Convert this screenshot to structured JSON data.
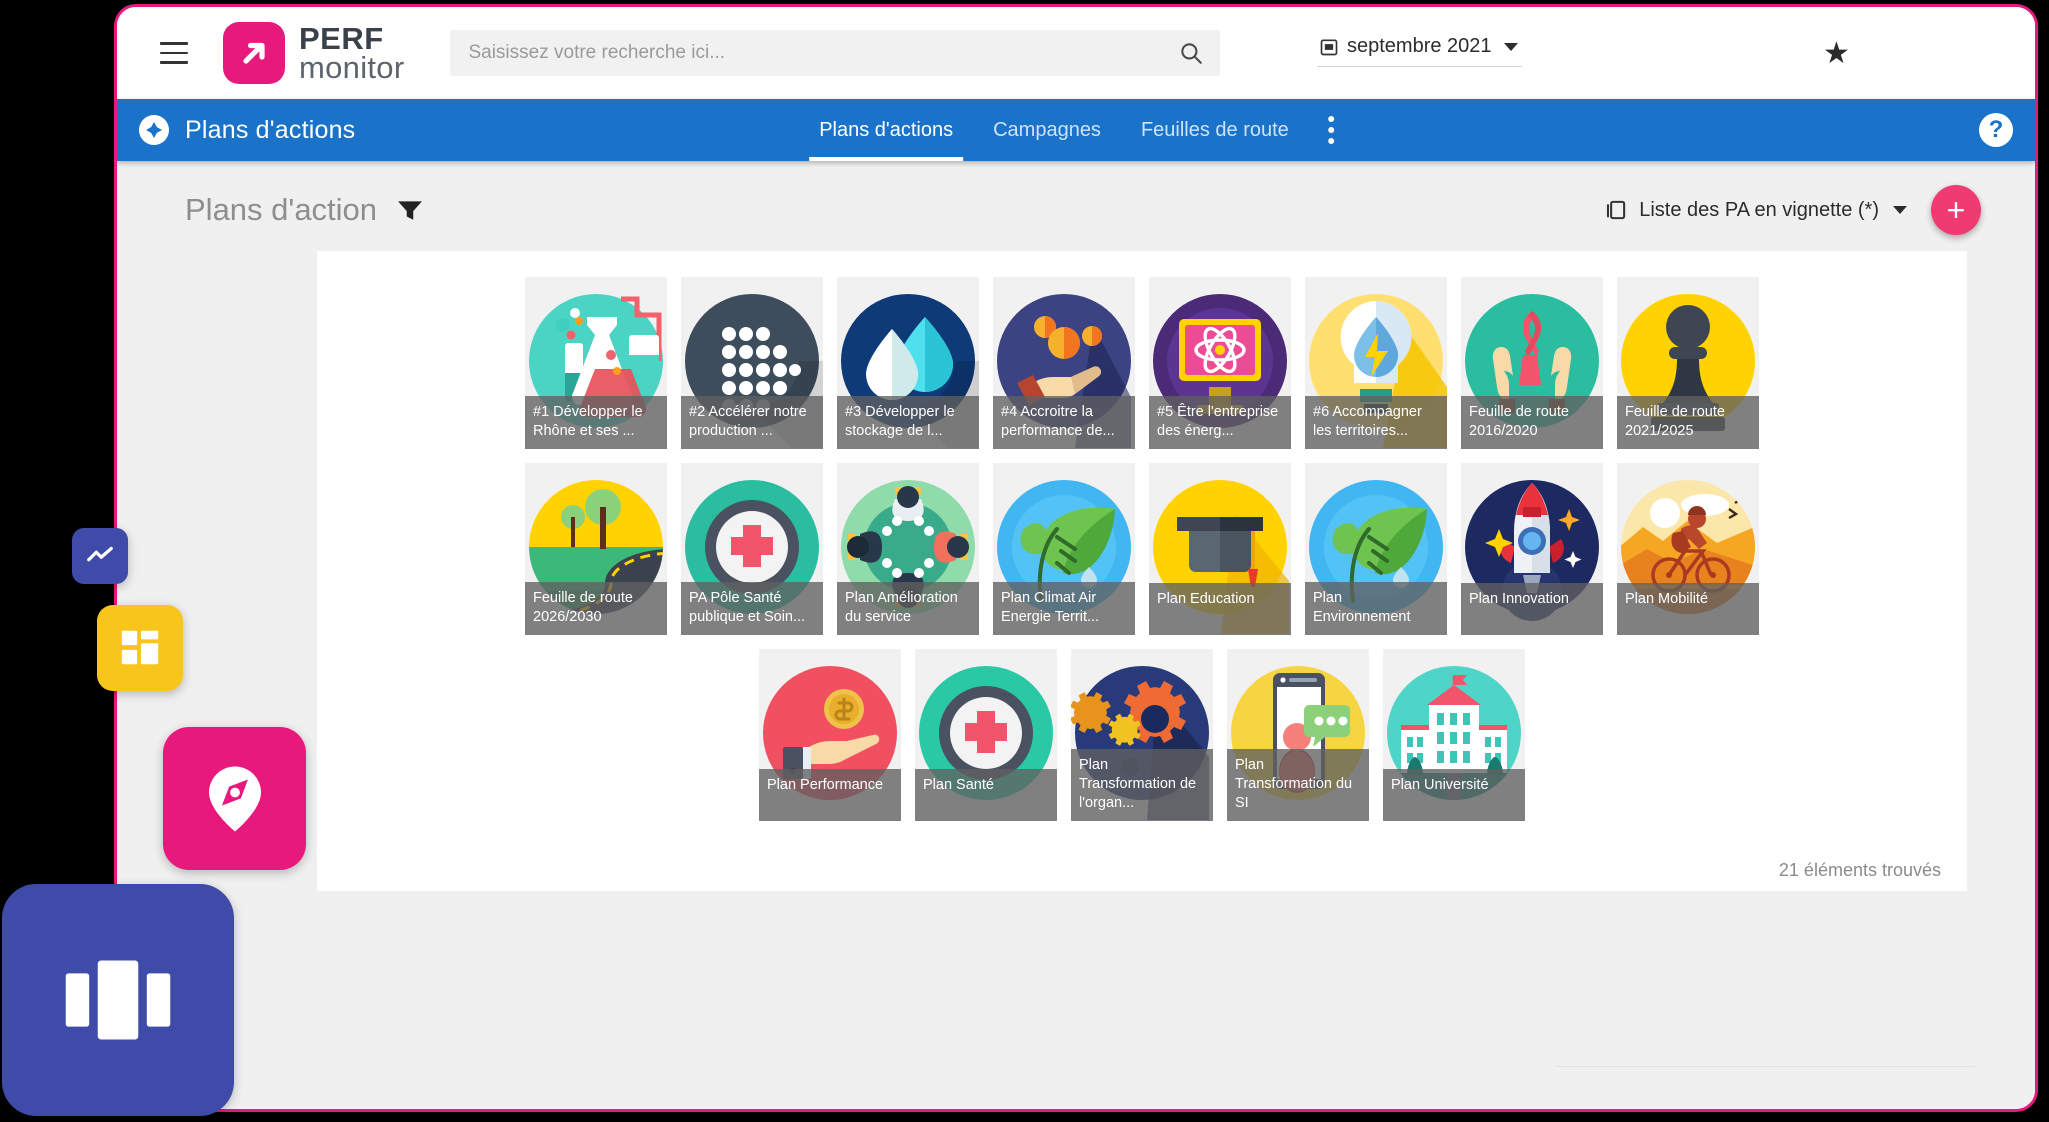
{
  "header": {
    "menu_icon": "hamburger-icon",
    "logo": {
      "line1": "PERF",
      "line2": "monitor",
      "mark_icon": "arrow-up-right-icon",
      "brand_color": "#e8197d"
    },
    "search": {
      "placeholder": "Saisissez votre recherche ici...",
      "value": "",
      "icon": "search-icon"
    },
    "period": {
      "label": "septembre 2021",
      "icon": "calendar-icon",
      "caret": "chevron-down-icon"
    },
    "favorites_icon": "star-icon",
    "avatar": "user-avatar"
  },
  "navbar": {
    "section_icon": "compass-icon",
    "section_title": "Plans d'actions",
    "tabs": [
      {
        "label": "Plans d'actions",
        "active": true
      },
      {
        "label": "Campagnes",
        "active": false
      },
      {
        "label": "Feuilles de route",
        "active": false
      }
    ],
    "overflow_icon": "kebab-menu-icon",
    "help_label": "?",
    "accent_color": "#1a73c8"
  },
  "page": {
    "title": "Plans d'action",
    "filter_icon": "filter-icon",
    "view_selector": {
      "label": "Liste des PA en vignette (*)",
      "icon": "copy-icon",
      "caret": "chevron-down-icon"
    },
    "add_button_label": "+",
    "add_button_color": "#ef3b72",
    "results_count": "21 éléments trouvés"
  },
  "tiles": [
    [
      {
        "label": "#1 Développer le Rhône et ses ...",
        "art": "lab-flasks",
        "bg": "#3fcfc0"
      },
      {
        "label": "#2 Accélérer notre production ...",
        "art": "dot-matrix",
        "bg": "#3d4d5c"
      },
      {
        "label": "#3 Développer le stockage de l...",
        "art": "water-drops",
        "bg": "#0e3a78"
      },
      {
        "label": "#4 Accroitre la performance de...",
        "art": "hand-coins",
        "bg": "#3b4383"
      },
      {
        "label": "#5 Être l'entreprise des énerg...",
        "art": "atom-screen",
        "bg": "#4b2a77"
      },
      {
        "label": "#6 Accompagner les territoires...",
        "art": "bulb-drop",
        "bg": "#ffd64d"
      },
      {
        "label": "Feuille de route 2016/2020",
        "art": "hands-ribbon",
        "bg": "#2bbda0"
      },
      {
        "label": "Feuille de route 2021/2025",
        "art": "chess-pawn",
        "bg": "#ffd200"
      }
    ],
    [
      {
        "label": "Feuille de route 2026/2030",
        "art": "road-trees",
        "bg": "#ffd200"
      },
      {
        "label": "PA Pôle Santé publique et Soin...",
        "art": "medical-cross",
        "bg": "#2bbda0"
      },
      {
        "label": "Plan Amélioration du service",
        "art": "meeting-table",
        "bg": "#8fdcaa"
      },
      {
        "label": "Plan Climat Air Energie Territ...",
        "art": "leaf-sprout",
        "bg": "#41b6f0"
      },
      {
        "label": "Plan Education",
        "art": "graduation-cap",
        "bg": "#ffd200"
      },
      {
        "label": "Plan Environnement",
        "art": "leaf-sprout",
        "bg": "#41b6f0"
      },
      {
        "label": "Plan Innovation",
        "art": "rocket",
        "bg": "#1d2a62"
      },
      {
        "label": "Plan Mobilité",
        "art": "cyclist",
        "bg": "#ffdd8a"
      }
    ],
    [
      {
        "label": "Plan Performance",
        "art": "hand-coin-red",
        "bg": "#f0505f"
      },
      {
        "label": "Plan Santé",
        "art": "medical-cross",
        "bg": "#2bc8a6"
      },
      {
        "label": "Plan Transformation de l'organ...",
        "art": "gears",
        "bg": "#283a7a"
      },
      {
        "label": "Plan Transformation du SI",
        "art": "phone-chat",
        "bg": "#f7d441"
      },
      {
        "label": "Plan Université",
        "art": "university",
        "bg": "#4fd4c8"
      }
    ]
  ],
  "launchers": [
    {
      "name": "chart-launcher",
      "icon": "trend-line-icon",
      "color": "#3f4ba8"
    },
    {
      "name": "dashboard-launcher",
      "icon": "grid-tiles-icon",
      "color": "#f8c51c"
    },
    {
      "name": "map-launcher",
      "icon": "compass-pin-icon",
      "color": "#e8197d"
    },
    {
      "name": "panels-launcher",
      "icon": "panels-icon",
      "color": "#3f4ba8"
    }
  ]
}
